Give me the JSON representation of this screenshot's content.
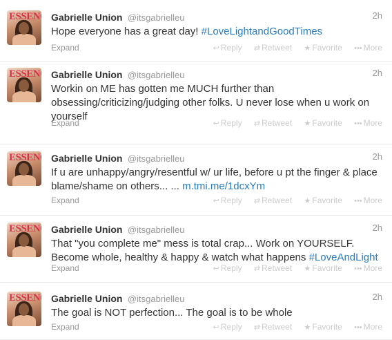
{
  "author": {
    "name": "Gabrielle Union",
    "handle": "@itsgabrielleu",
    "avatar_text": "ESSENCE"
  },
  "actions": {
    "expand": "Expand",
    "reply": "Reply",
    "retweet": "Retweet",
    "favorite": "Favorite",
    "more": "More"
  },
  "tweets": [
    {
      "time": "2h",
      "text": "Hope everyone has a great day! ",
      "hashtag": "#LoveLightandGoodTimes"
    },
    {
      "time": "2h",
      "text": "Workin on ME has gotten me MUCH further than obsessing/criticizing/judging other folks. U never lose when u work on yourself"
    },
    {
      "time": "2h",
      "text": "If u are unhappy/angry/resentful w/ ur life, before u pt the finger & place blame/shame on others... ... ",
      "link": "m.tmi.me/1dcxYm"
    },
    {
      "time": "2h",
      "text": "That \"you complete me\" mess is total crap... Work on YOURSELF. Become whole, healthy & happy & watch what happens ",
      "hashtag": "#LoveAndLight"
    },
    {
      "time": "2h",
      "text": "The goal is NOT perfection... The goal is to be whole"
    }
  ],
  "colors": {
    "link": "#2a7dbf",
    "muted": "#999999",
    "text": "#333333"
  }
}
